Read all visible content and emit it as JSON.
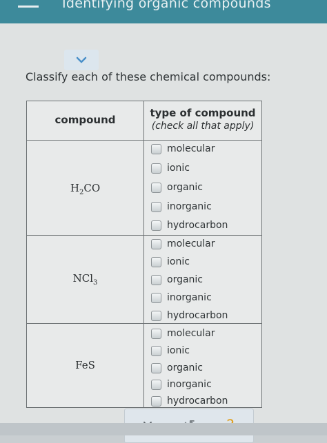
{
  "header": {
    "title": "Identifying organic compounds"
  },
  "question": {
    "prompt": "Classify each of these chemical compounds:"
  },
  "table": {
    "col_compound": "compound",
    "col_type": "type of compound",
    "col_type_hint": "(check all that apply)",
    "rows": [
      {
        "formula_main": "H",
        "formula_sub": "2",
        "formula_rest": "CO",
        "options": [
          "molecular",
          "ionic",
          "organic",
          "inorganic",
          "hydrocarbon"
        ]
      },
      {
        "formula_main": "NCl",
        "formula_sub": "3",
        "formula_rest": "",
        "options": [
          "molecular",
          "ionic",
          "organic",
          "inorganic",
          "hydrocarbon"
        ]
      },
      {
        "formula_main": "FeS",
        "formula_sub": "",
        "formula_rest": "",
        "options": [
          "molecular",
          "ionic",
          "organic",
          "inorganic",
          "hydrocarbon"
        ]
      }
    ]
  },
  "toolbar": {
    "clear_icon": "×",
    "undo_icon": "↺",
    "help_icon": "?"
  },
  "colors": {
    "topbar": "#3d8a9b",
    "accent": "#4a90c9",
    "help": "#e0a020"
  }
}
